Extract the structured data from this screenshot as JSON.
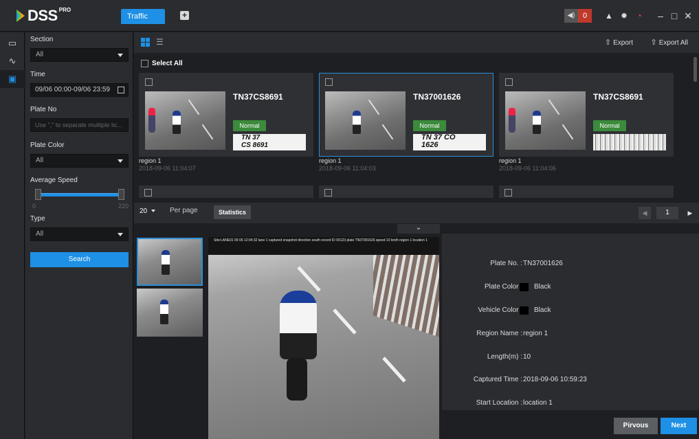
{
  "app": {
    "name": "DSS",
    "edition": "PRO"
  },
  "tabs": [
    {
      "label": "Traffic"
    }
  ],
  "alarm": {
    "count": "0"
  },
  "filters": {
    "section_label": "Section",
    "section_value": "All",
    "time_label": "Time",
    "time_value": "09/06 00:00-09/06 23:59",
    "plate_no_label": "Plate No",
    "plate_no_placeholder": "Use \",\" to separate multiple lic...",
    "plate_color_label": "Plate Color",
    "plate_color_value": "All",
    "speed_label": "Average Speed",
    "speed_min": "0",
    "speed_max": "220",
    "type_label": "Type",
    "type_value": "All",
    "search_label": "Search"
  },
  "toolbar": {
    "export_label": "Export",
    "export_all_label": "Export All"
  },
  "grid": {
    "select_all_label": "Select All",
    "cards": [
      {
        "plate": "TN37CS8691",
        "status": "Normal",
        "plate_text": "TN 37\nCS 8691",
        "region": "region 1",
        "time": "2018-09-06 11:04:07",
        "selected": false
      },
      {
        "plate": "TN37001626",
        "status": "Normal",
        "plate_text": "TN 37 CO\n1626",
        "region": "region 1",
        "time": "2018-09-06 11:04:03",
        "selected": true
      },
      {
        "plate": "TN37CS8691",
        "status": "Normal",
        "plate_text": "",
        "region": "region 1",
        "time": "2018-09-06 11:04:06",
        "selected": false
      }
    ]
  },
  "pager": {
    "per_page_value": "20",
    "per_page_label": "Per page",
    "statistics_label": "Statistics",
    "current_page": "1"
  },
  "detail": {
    "overlay_text": "Site:LANE01 09 06 12:04:32 lane 1 captured snapshot direction south record ID 00123 plate TN37001626 speed 10 km/h region 1 location 1",
    "plate_no_label": "Plate No. :",
    "plate_no": "TN37001626",
    "plate_color_label": "Plate Color :",
    "plate_color": "Black",
    "vehicle_color_label": "Vehicle Color :",
    "vehicle_color": "Black",
    "region_label": "Region Name :",
    "region": "region 1",
    "length_label": "Length(m) :",
    "length": "10",
    "captured_label": "Captured Time :",
    "captured": "2018-09-06 10:59:23",
    "start_label": "Start Location :",
    "start": "location 1",
    "prev_label": "Pirvous",
    "next_label": "Next"
  }
}
